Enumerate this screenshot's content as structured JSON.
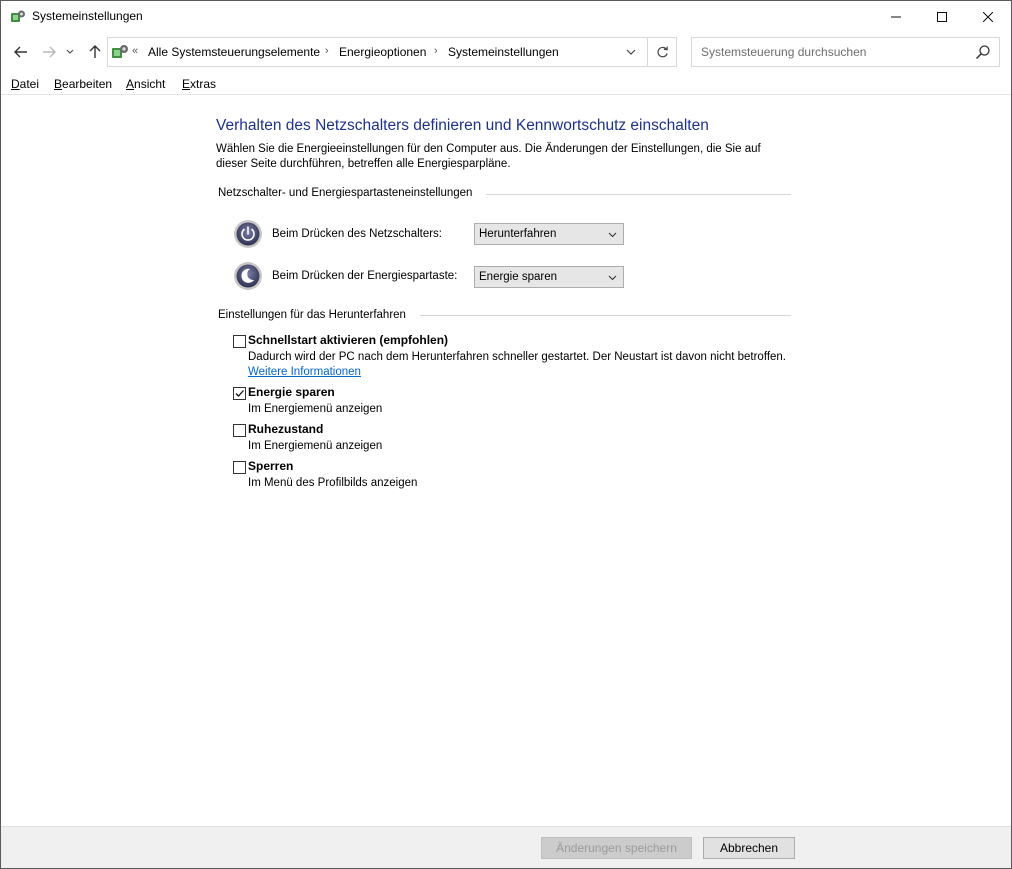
{
  "window": {
    "title": "Systemeinstellungen",
    "controls": {
      "minimize": "—",
      "maximize": "☐",
      "close": "✕"
    }
  },
  "address": {
    "overflow": "«",
    "segments": [
      "Alle Systemsteuerungselemente",
      "Energieoptionen",
      "Systemeinstellungen"
    ],
    "separator": "›"
  },
  "search": {
    "placeholder": "Systemsteuerung durchsuchen"
  },
  "menu": {
    "items": [
      {
        "accel": "D",
        "rest": "atei"
      },
      {
        "accel": "B",
        "rest": "earbeiten"
      },
      {
        "accel": "A",
        "rest": "nsicht"
      },
      {
        "accel": "E",
        "rest": "xtras"
      }
    ]
  },
  "page": {
    "title": "Verhalten des Netzschalters definieren und Kennwortschutz einschalten",
    "description": "Wählen Sie die Energieeinstellungen für den Computer aus. Die Änderungen der Einstellungen, die Sie auf dieser Seite durchführen, betreffen alle Energiesparpläne."
  },
  "button_settings": {
    "heading": "Netzschalter- und Energiespartasteneinstellungen",
    "power_button": {
      "label": "Beim Drücken des Netzschalters:",
      "value": "Herunterfahren"
    },
    "sleep_button": {
      "label": "Beim Drücken der Energiespartaste:",
      "value": "Energie sparen"
    }
  },
  "shutdown_settings": {
    "heading": "Einstellungen für das Herunterfahren",
    "options": [
      {
        "title": "Schnellstart aktivieren (empfohlen)",
        "desc": "Dadurch wird der PC nach dem Herunterfahren schneller gestartet. Der Neustart ist davon nicht betroffen.",
        "link": "Weitere Informationen",
        "checked": false
      },
      {
        "title": "Energie sparen",
        "desc": "Im Energiemenü anzeigen",
        "checked": true
      },
      {
        "title": "Ruhezustand",
        "desc": "Im Energiemenü anzeigen",
        "checked": false
      },
      {
        "title": "Sperren",
        "desc": "Im Menü des Profilbilds anzeigen",
        "checked": false
      }
    ]
  },
  "footer": {
    "save_label": "Änderungen speichern",
    "cancel_label": "Abbrechen"
  },
  "colors": {
    "title_blue": "#1e3287",
    "link_blue": "#0066cc"
  }
}
